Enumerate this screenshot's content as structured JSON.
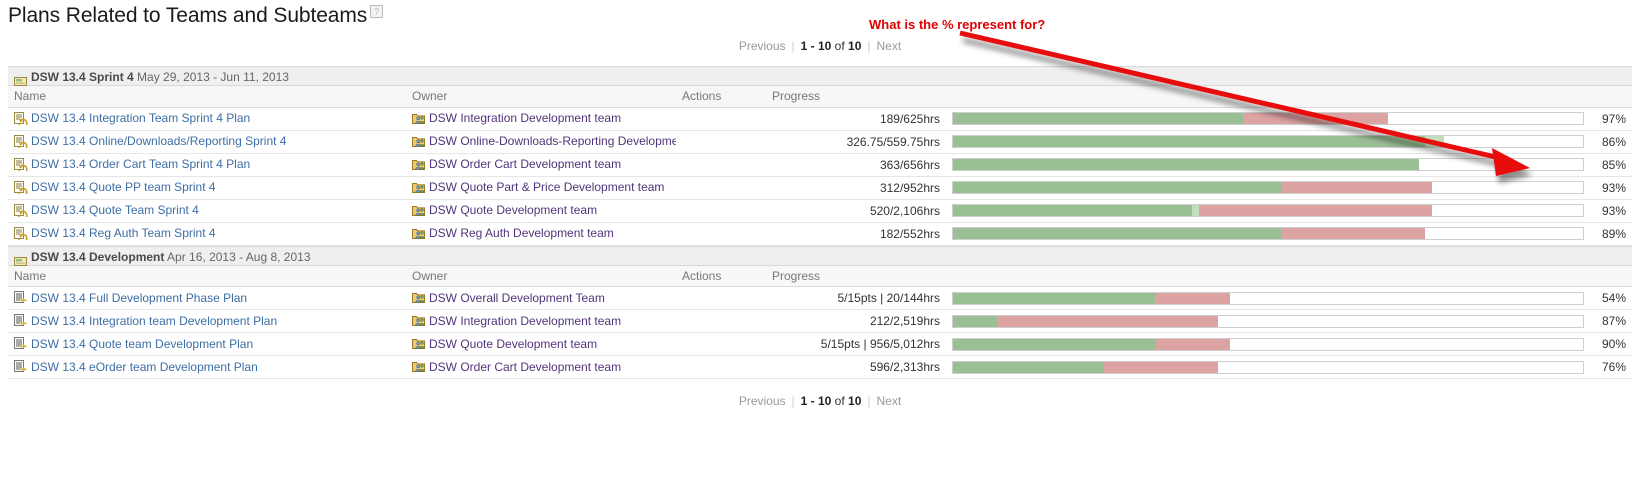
{
  "header": {
    "title": "Plans Related to Teams and Subteams",
    "help_icon": "help-icon",
    "help_glyph": "?"
  },
  "pager": {
    "previous": "Previous",
    "range_prefix": "1 - 10",
    "range_mid": "of",
    "range_total": "10",
    "next": "Next",
    "divider": "|"
  },
  "columns": {
    "name": "Name",
    "owner": "Owner",
    "actions": "Actions",
    "progress": "Progress"
  },
  "annotation": {
    "text": "What is the % represent for?",
    "color": "#e00000",
    "arrow_color": "#e81010",
    "points_to_row": "DSW 13.4 Order Cart Team Sprint 4 Plan"
  },
  "colors": {
    "bar_green": "#9bbf95",
    "bar_light_green": "#c4dcc0",
    "bar_pink": "#dda2a2",
    "link_blue": "#3d6ea5",
    "link_purple": "#51347a",
    "group_bg": "#efefef"
  },
  "groups": [
    {
      "name": "DSW 13.4 Sprint 4",
      "dates": "May 29, 2013 - Jun 11, 2013",
      "icon": "plan-card-icon",
      "rows": [
        {
          "name": "DSW 13.4 Integration Team Sprint 4 Plan",
          "name_icon": "sprint-plan-icon",
          "owner": "DSW Integration Development team",
          "owner_icon": "team-folder-icon",
          "actions": "",
          "progress": "189/625hrs",
          "percent": "97%",
          "green_pct": 46,
          "light_green_pct": 0,
          "pink_pct": 23
        },
        {
          "name": "DSW 13.4 Online/Downloads/Reporting Sprint 4",
          "name_icon": "sprint-plan-icon",
          "owner": "DSW Online-Downloads-Reporting Developme",
          "owner_icon": "team-folder-icon",
          "actions": "",
          "progress": "326.75/559.75hrs",
          "percent": "86%",
          "green_pct": 75,
          "light_green_pct": 3,
          "pink_pct": 0
        },
        {
          "name": "DSW 13.4 Order Cart Team Sprint 4 Plan",
          "name_icon": "sprint-plan-icon",
          "owner": "DSW Order Cart Development team",
          "owner_icon": "team-folder-icon",
          "actions": "",
          "progress": "363/656hrs",
          "percent": "85%",
          "green_pct": 74,
          "light_green_pct": 0,
          "pink_pct": 0
        },
        {
          "name": "DSW 13.4 Quote PP team Sprint 4",
          "name_icon": "sprint-plan-icon",
          "owner": "DSW Quote Part & Price Development team",
          "owner_icon": "team-folder-icon",
          "actions": "",
          "progress": "312/952hrs",
          "percent": "93%",
          "green_pct": 52,
          "light_green_pct": 0,
          "pink_pct": 24
        },
        {
          "name": "DSW 13.4 Quote Team Sprint 4",
          "name_icon": "sprint-plan-icon",
          "owner": "DSW Quote Development team",
          "owner_icon": "team-folder-icon",
          "actions": "",
          "progress": "520/2,106hrs",
          "percent": "93%",
          "green_pct": 38,
          "light_green_pct": 1,
          "pink_pct": 37
        },
        {
          "name": "DSW 13.4 Reg Auth Team Sprint 4",
          "name_icon": "sprint-plan-icon",
          "owner": "DSW Reg Auth Development team",
          "owner_icon": "team-folder-icon",
          "actions": "",
          "progress": "182/552hrs",
          "percent": "89%",
          "green_pct": 52,
          "light_green_pct": 0,
          "pink_pct": 23
        }
      ]
    },
    {
      "name": "DSW 13.4 Development",
      "dates": "Apr 16, 2013 - Aug 8, 2013",
      "icon": "plan-card-icon",
      "rows": [
        {
          "name": "DSW 13.4 Full Development Phase Plan",
          "name_icon": "phase-plan-icon",
          "owner": "DSW Overall Development Team",
          "owner_icon": "team-folder-icon",
          "actions": "",
          "progress": "5/15pts | 20/144hrs",
          "percent": "54%",
          "green_pct": 32,
          "light_green_pct": 0,
          "pink_pct": 12
        },
        {
          "name": "DSW 13.4 Integration team Development Plan",
          "name_icon": "phase-plan-icon",
          "owner": "DSW Integration Development team",
          "owner_icon": "team-folder-icon",
          "actions": "",
          "progress": "212/2,519hrs",
          "percent": "87%",
          "green_pct": 7,
          "light_green_pct": 0,
          "pink_pct": 35
        },
        {
          "name": "DSW 13.4 Quote team Development Plan",
          "name_icon": "phase-plan-icon",
          "owner": "DSW Quote Development team",
          "owner_icon": "team-folder-icon",
          "actions": "",
          "progress": "5/15pts | 956/5,012hrs",
          "percent": "90%",
          "green_pct": 32,
          "light_green_pct": 0,
          "pink_pct": 12
        },
        {
          "name": "DSW 13.4 eOrder team Development Plan",
          "name_icon": "phase-plan-icon",
          "owner": "DSW Order Cart Development team",
          "owner_icon": "team-folder-icon",
          "actions": "",
          "progress": "596/2,313hrs",
          "percent": "76%",
          "green_pct": 24,
          "light_green_pct": 0,
          "pink_pct": 18
        }
      ]
    }
  ]
}
